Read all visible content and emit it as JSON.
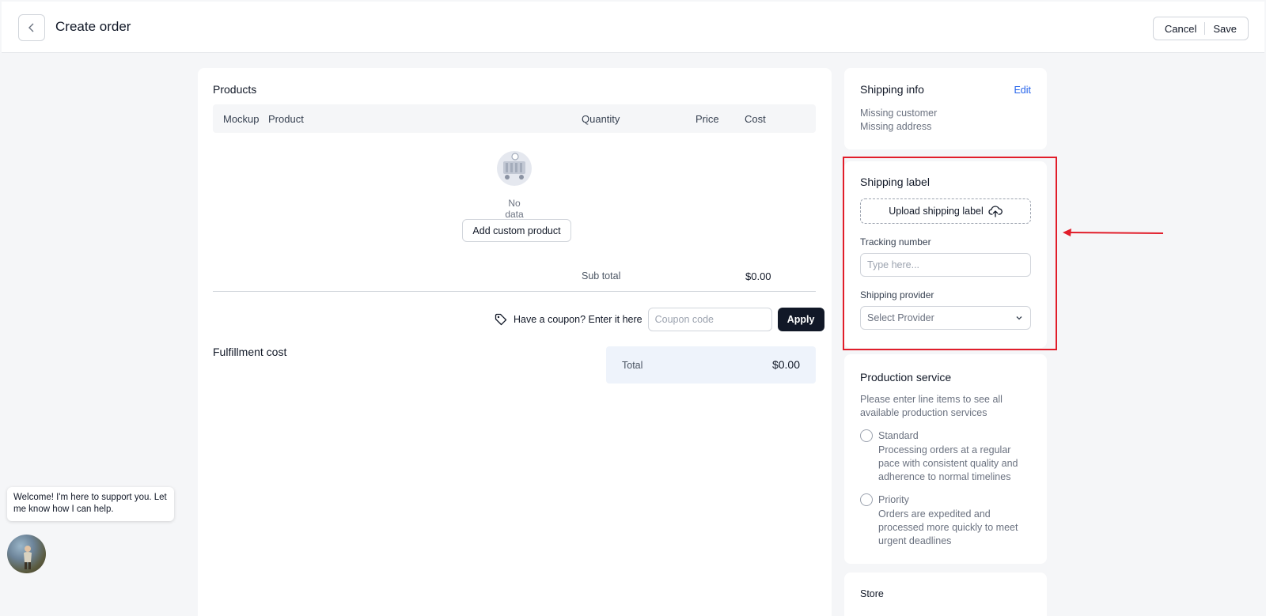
{
  "header": {
    "title": "Create order",
    "cancel_label": "Cancel",
    "save_label": "Save"
  },
  "products": {
    "title": "Products",
    "columns": [
      "Mockup",
      "Product",
      "Quantity",
      "Price",
      "Cost"
    ],
    "empty_text": "No data",
    "add_custom_label": "Add custom product",
    "subtotal_label": "Sub total",
    "subtotal_value": "$0.00",
    "coupon_prompt": "Have a coupon? Enter it here",
    "coupon_placeholder": "Coupon code",
    "apply_label": "Apply"
  },
  "fulfillment": {
    "title": "Fulfillment cost",
    "total_label": "Total",
    "total_value": "$0.00"
  },
  "shipping_info": {
    "title": "Shipping info",
    "edit_label": "Edit",
    "customer_status": "Missing customer",
    "address_status": "Missing address"
  },
  "shipping_label": {
    "title": "Shipping label",
    "upload_label": "Upload shipping label",
    "tracking_label": "Tracking number",
    "tracking_placeholder": "Type here...",
    "provider_label": "Shipping provider",
    "provider_placeholder": "Select Provider"
  },
  "production_service": {
    "title": "Production service",
    "description": "Please enter line items to see all available production services",
    "options": [
      {
        "title": "Standard",
        "description": "Processing orders at a regular pace with consistent quality and adherence to normal timelines"
      },
      {
        "title": "Priority",
        "description": "Orders are expedited and processed more quickly to meet urgent deadlines"
      }
    ]
  },
  "store": {
    "label": "Store"
  },
  "chat": {
    "message": "Welcome! I'm here to support you. Let me know how I can help."
  },
  "colors": {
    "highlight": "#e11d2a",
    "primary_button": "#111827",
    "link": "#2563eb"
  }
}
